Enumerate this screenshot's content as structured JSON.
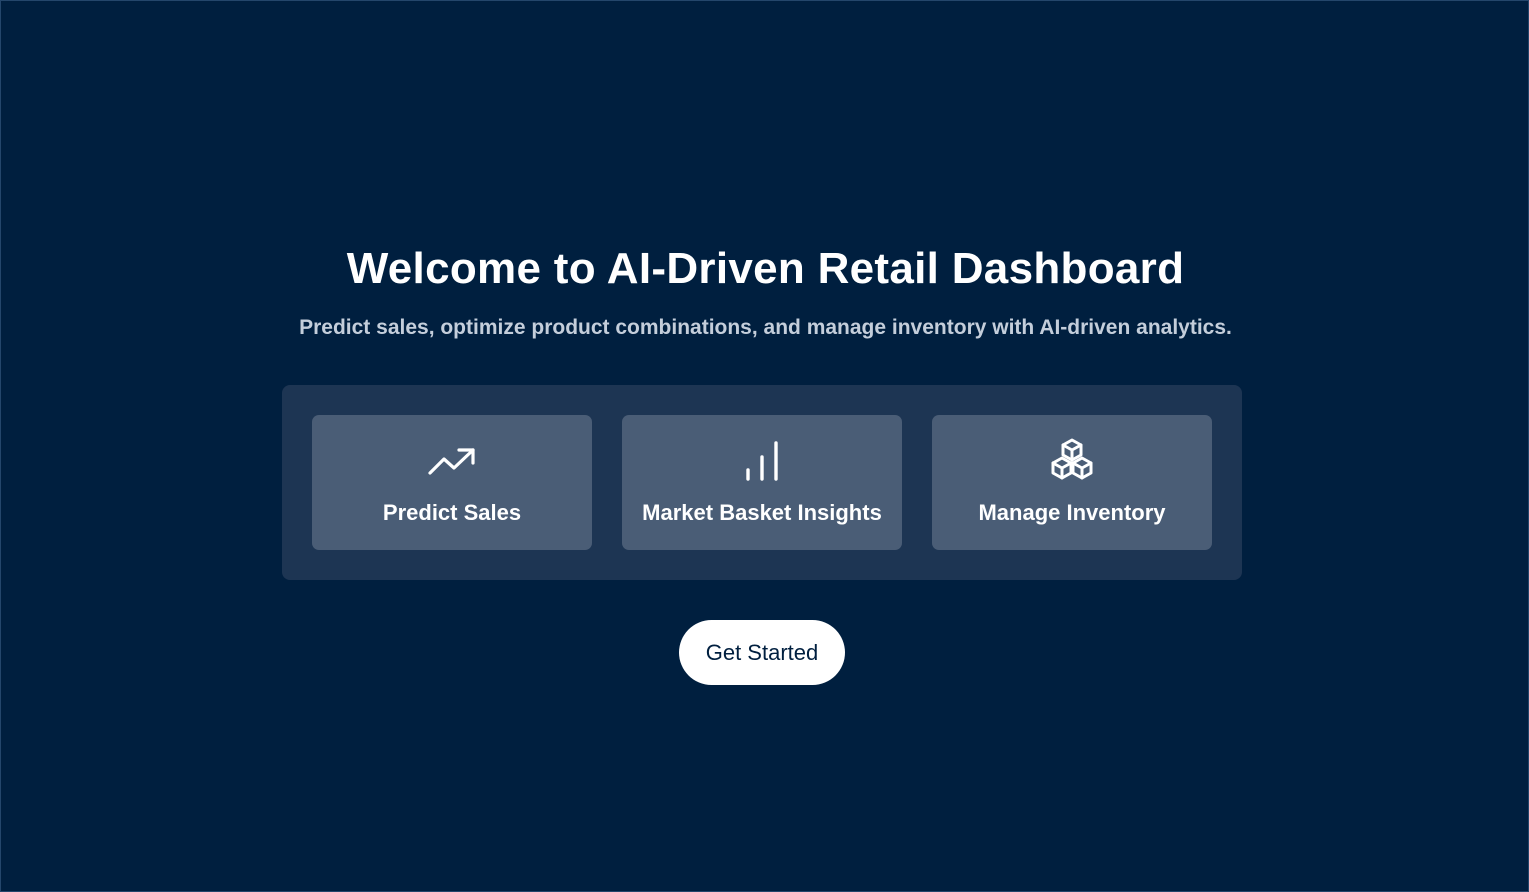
{
  "hero": {
    "title": "Welcome to AI-Driven Retail Dashboard",
    "subtitle": "Predict sales, optimize product combinations, and manage inventory with AI-driven analytics."
  },
  "features": [
    {
      "label": "Predict Sales",
      "icon": "trending-up-icon"
    },
    {
      "label": "Market Basket Insights",
      "icon": "bar-chart-icon"
    },
    {
      "label": "Manage Inventory",
      "icon": "boxes-icon"
    }
  ],
  "cta": {
    "label": "Get Started"
  },
  "colors": {
    "background": "#001f3f",
    "panel": "#1d3553",
    "card": "#4a5d76",
    "button": "#ffffff",
    "text": "#ffffff"
  }
}
